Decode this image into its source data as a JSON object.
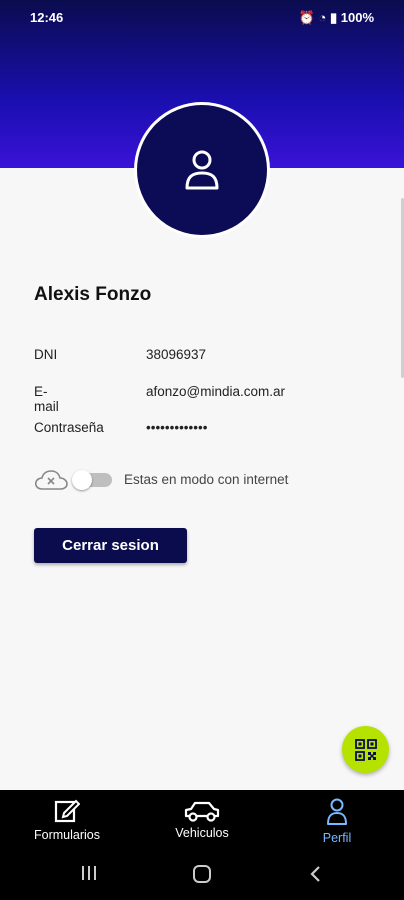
{
  "status": {
    "time": "12:46",
    "battery": "100%"
  },
  "profile": {
    "name": "Alexis Fonzo",
    "fields": [
      {
        "label": "DNI",
        "value": "38096937"
      },
      {
        "label": "E-mail",
        "value": "afonzo@mindia.com.ar"
      },
      {
        "label": "Contraseña",
        "value": "•••••••••••••"
      }
    ]
  },
  "connection": {
    "mode_text": "Estas en modo con internet",
    "toggle_on": false
  },
  "logout": {
    "label": "Cerrar sesion"
  },
  "nav": {
    "items": [
      {
        "label": "Formularios",
        "icon": "form-edit-icon"
      },
      {
        "label": "Vehiculos",
        "icon": "car-icon"
      },
      {
        "label": "Perfil",
        "icon": "person-icon"
      }
    ],
    "active": "Perfil"
  },
  "colors": {
    "primary": "#0b0c4e",
    "accent": "#b6e200",
    "active_nav": "#7ab8ff"
  }
}
